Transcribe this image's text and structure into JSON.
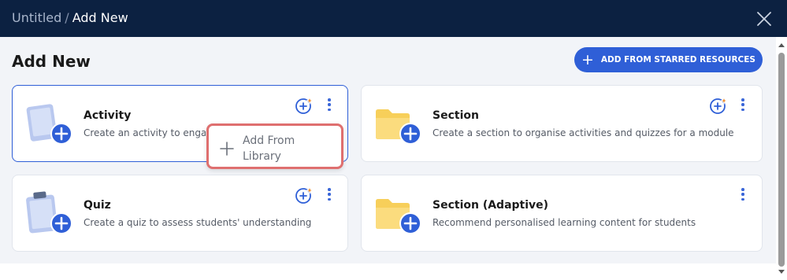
{
  "header": {
    "breadcrumb_root": "Untitled",
    "breadcrumb_separator": "/",
    "breadcrumb_current": "Add New",
    "close_icon": "close-icon"
  },
  "page_title": "Add New",
  "starred_button": {
    "icon": "plus-icon",
    "label": "ADD FROM STARRED RESOURCES"
  },
  "cards": [
    {
      "title": "Activity",
      "description": "Create an activity to engage students",
      "icon": "tablet-plus-icon",
      "has_star_add": true,
      "selected": true
    },
    {
      "title": "Section",
      "description": "Create a section to organise activities and quizzes for a module",
      "icon": "folder-plus-icon",
      "has_star_add": true,
      "selected": false
    },
    {
      "title": "Quiz",
      "description": "Create a quiz to assess students' understanding",
      "icon": "clipboard-plus-icon",
      "has_star_add": true,
      "selected": false
    },
    {
      "title": "Section (Adaptive)",
      "description": "Recommend personalised learning content for students",
      "icon": "folder-plus-icon",
      "has_star_add": false,
      "selected": false
    }
  ],
  "popup_menu": {
    "icon": "plus-icon",
    "label": "Add From Library"
  },
  "colors": {
    "header_bg": "#0c2141",
    "accent": "#2f5fd7",
    "star": "#f08a24",
    "folder": "#f7cf5a",
    "highlight_border": "#df6f6f"
  }
}
